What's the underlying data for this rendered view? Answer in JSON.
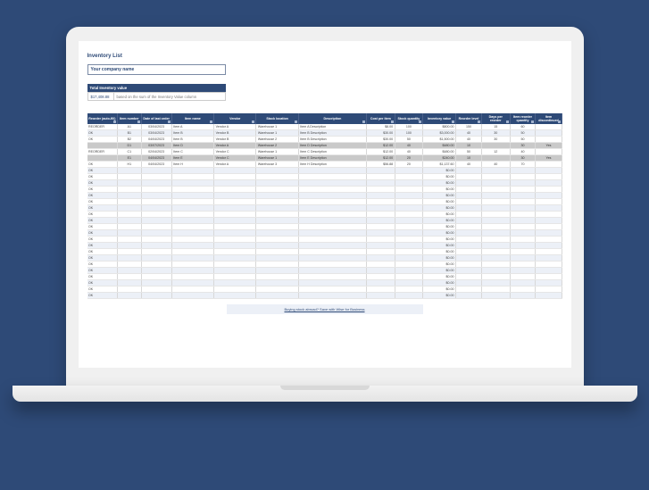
{
  "doc": {
    "title": "Inventory List",
    "company_name": "Your company name",
    "tiv_label": "Total Inventory value",
    "tiv_value": "$17,408.88",
    "tiv_note": "based on the sum of the Inventory Value column",
    "footer": "Buying stock abroad? Save with Wise for Business"
  },
  "columns": [
    "Reorder (auto-fill)",
    "Item number",
    "Date of last order",
    "Item name",
    "Vendor",
    "Stock location",
    "Description",
    "Cost per item",
    "Stock quantity",
    "Inventory value",
    "Reorder level",
    "Days per reorder",
    "Item reorder quantity",
    "Item discontinued"
  ],
  "rows": [
    {
      "hi": false,
      "reo": "REORDER",
      "num": "A1",
      "date": "03/04/2023",
      "name": "Item A",
      "vendor": "Vendor A",
      "loc": "Warehouse 1",
      "desc": "Item A Description",
      "cpi": "$8.00",
      "qty": "100",
      "val": "$800.00",
      "lvl": "150",
      "dpr": "15",
      "rq": "60",
      "disc": ""
    },
    {
      "hi": false,
      "reo": "OK",
      "num": "B1",
      "date": "03/04/2023",
      "name": "Item B",
      "vendor": "Vendor B",
      "loc": "Warehouse 1",
      "desc": "Item B Description",
      "cpi": "$30.00",
      "qty": "100",
      "val": "$3,000.00",
      "lvl": "40",
      "dpr": "30",
      "rq": "50",
      "disc": ""
    },
    {
      "hi": false,
      "reo": "OK",
      "num": "B2",
      "date": "04/04/2023",
      "name": "Item B",
      "vendor": "Vendor B",
      "loc": "Warehouse 2",
      "desc": "Item B Description",
      "cpi": "$30.00",
      "qty": "50",
      "val": "$1,500.00",
      "lvl": "40",
      "dpr": "30",
      "rq": "50",
      "disc": ""
    },
    {
      "hi": true,
      "reo": "",
      "num": "D1",
      "date": "03/07/2023",
      "name": "Item D",
      "vendor": "Vendor A",
      "loc": "Warehouse 2",
      "desc": "Item D Description",
      "cpi": "$12.00",
      "qty": "40",
      "val": "$480.00",
      "lvl": "10",
      "dpr": "",
      "rq": "30",
      "disc": "Yes"
    },
    {
      "hi": false,
      "reo": "REORDER",
      "num": "C1",
      "date": "02/04/2023",
      "name": "Item C",
      "vendor": "Vendor C",
      "loc": "Warehouse 1",
      "desc": "Item C Description",
      "cpi": "$12.00",
      "qty": "40",
      "val": "$480.00",
      "lvl": "50",
      "dpr": "12",
      "rq": "40",
      "disc": ""
    },
    {
      "hi": true,
      "reo": "",
      "num": "E1",
      "date": "04/04/2023",
      "name": "Item E",
      "vendor": "Vendor C",
      "loc": "Warehouse 1",
      "desc": "Item E Description",
      "cpi": "$12.00",
      "qty": "20",
      "val": "$240.00",
      "lvl": "10",
      "dpr": "",
      "rq": "30",
      "disc": "Yes"
    },
    {
      "hi": false,
      "reo": "OK",
      "num": "H1",
      "date": "04/04/2023",
      "name": "Item H",
      "vendor": "Vendor A",
      "loc": "Warehouse 3",
      "desc": "Item H Description",
      "cpi": "$56.88",
      "qty": "20",
      "val": "$1,137.60",
      "lvl": "40",
      "dpr": "40",
      "rq": "70",
      "disc": ""
    }
  ],
  "empty_rows": 21,
  "empty": {
    "reo": "OK",
    "val": "$0.00"
  }
}
